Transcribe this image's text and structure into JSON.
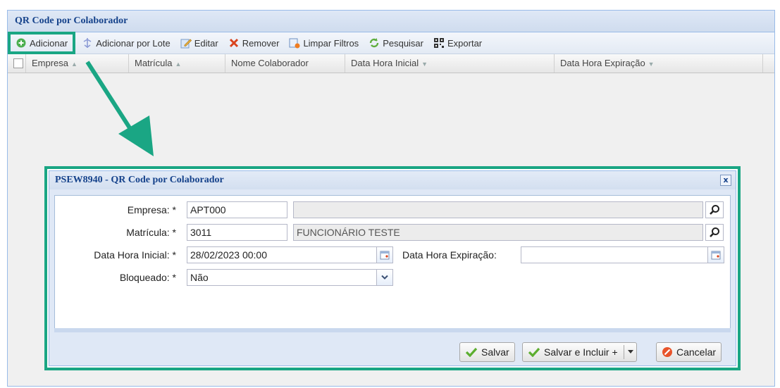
{
  "panel": {
    "title": "QR Code por Colaborador"
  },
  "toolbar": {
    "add": "Adicionar",
    "add_batch": "Adicionar por Lote",
    "edit": "Editar",
    "remove": "Remover",
    "clear_filters": "Limpar Filtros",
    "search": "Pesquisar",
    "export": "Exportar"
  },
  "grid": {
    "columns": [
      "Empresa",
      "Matrícula",
      "Nome Colaborador",
      "Data Hora Inicial",
      "Data Hora Expiração"
    ]
  },
  "dialog": {
    "title": "PSEW8940 - QR Code por Colaborador",
    "close_glyph": "x",
    "fields": {
      "empresa_label": "Empresa: *",
      "empresa_value": "APT000",
      "empresa_desc": "",
      "matricula_label": "Matrícula: *",
      "matricula_value": "3011",
      "matricula_desc": "FUNCIONÁRIO TESTE",
      "inicial_label": "Data Hora Inicial: *",
      "inicial_value": "28/02/2023 00:00",
      "expiracao_label": "Data Hora Expiração:",
      "expiracao_value": "",
      "bloqueado_label": "Bloqueado: *",
      "bloqueado_value": "Não"
    },
    "buttons": {
      "save": "Salvar",
      "save_include": "Salvar e Incluir +",
      "cancel": "Cancelar"
    }
  },
  "colors": {
    "highlight": "#1aa684",
    "header_text": "#15428b"
  }
}
